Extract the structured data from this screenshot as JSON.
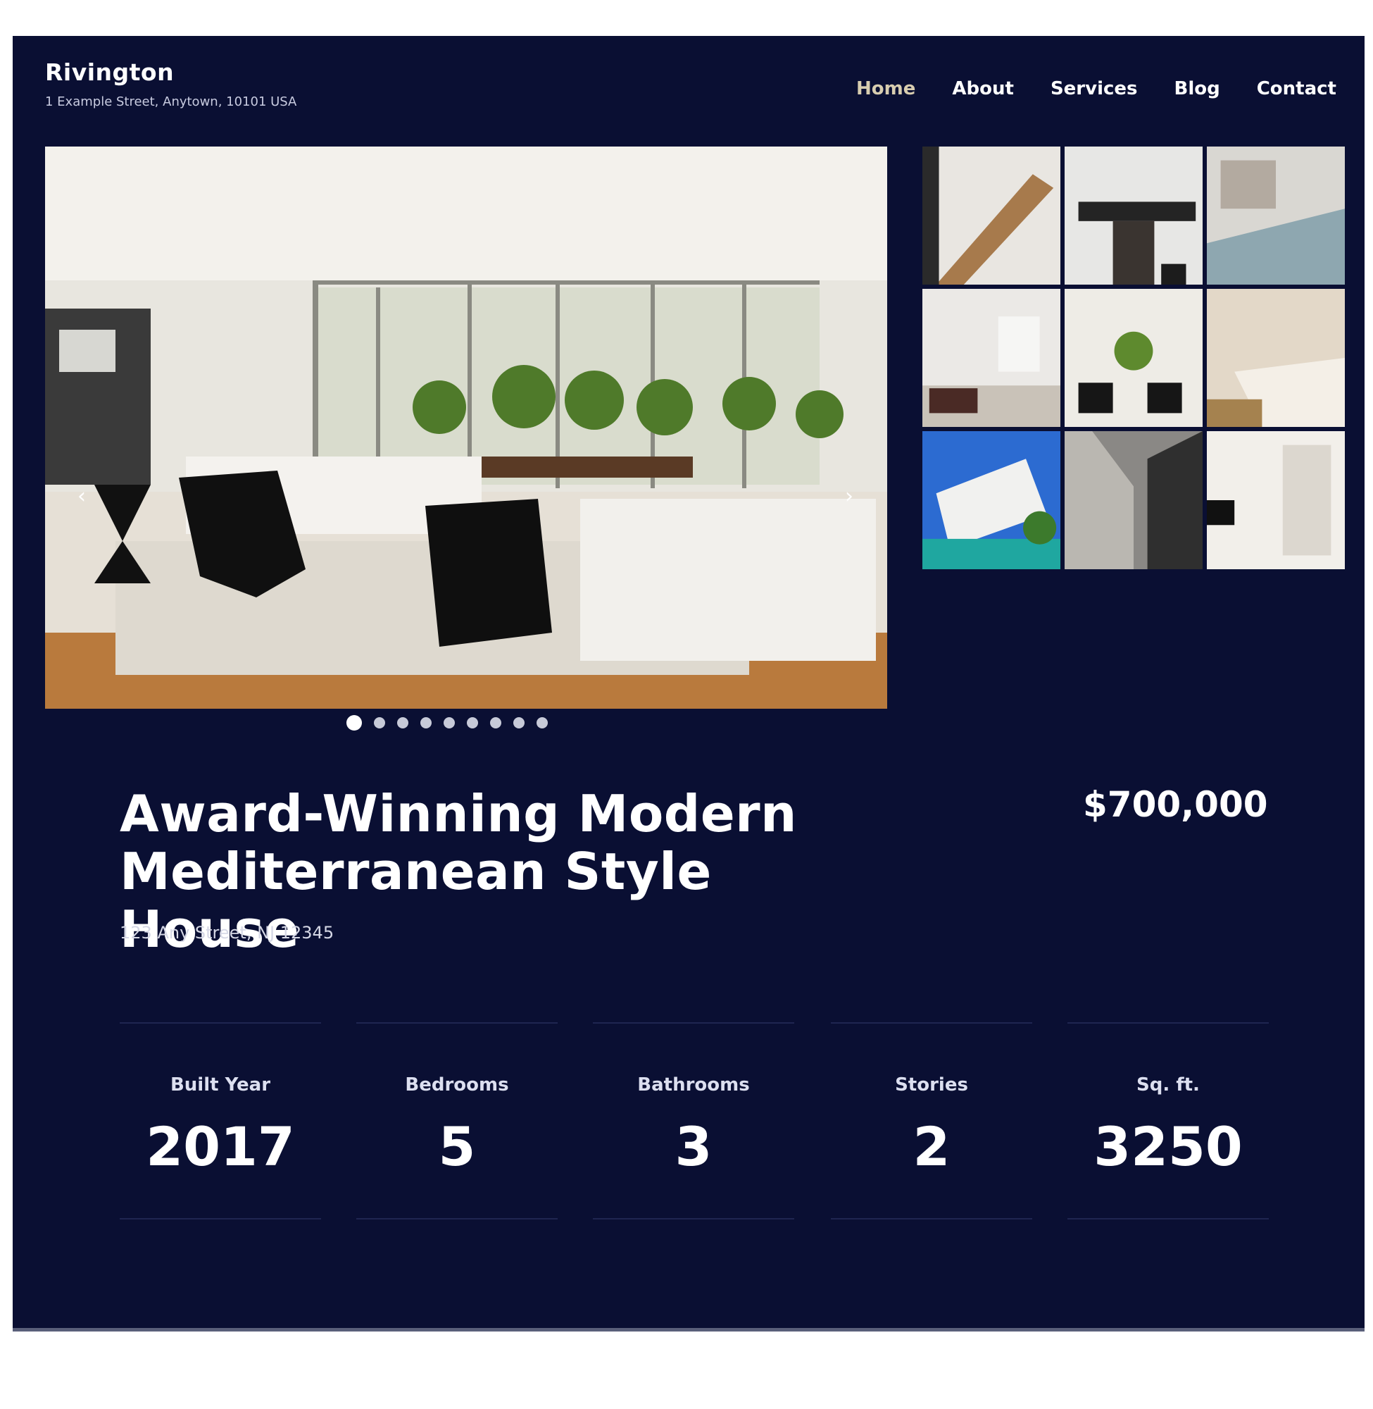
{
  "brand": {
    "name": "Rivington",
    "address": "1 Example Street, Anytown, 10101 USA"
  },
  "nav": {
    "items": [
      "Home",
      "About",
      "Services",
      "Blog",
      "Contact"
    ],
    "active": "Home"
  },
  "gallery": {
    "prev_icon": "chevron-left-icon",
    "next_icon": "chevron-right-icon",
    "slide_count": 9,
    "active_slide": 1,
    "thumbnail_count": 9
  },
  "listing": {
    "title_line1": "Award-Winning Modern",
    "title_line2": "Mediterranean Style House",
    "price": "$700,000",
    "address": "123 Any Street, NJ 12345"
  },
  "stats": [
    {
      "label": "Built Year",
      "value": "2017"
    },
    {
      "label": "Bedrooms",
      "value": "5"
    },
    {
      "label": "Bathrooms",
      "value": "3"
    },
    {
      "label": "Stories",
      "value": "2"
    },
    {
      "label": "Sq. ft.",
      "value": "3250"
    }
  ],
  "colors": {
    "background": "#0a0f33",
    "text": "#ffffff",
    "nav_active": "#d8cdb0"
  }
}
